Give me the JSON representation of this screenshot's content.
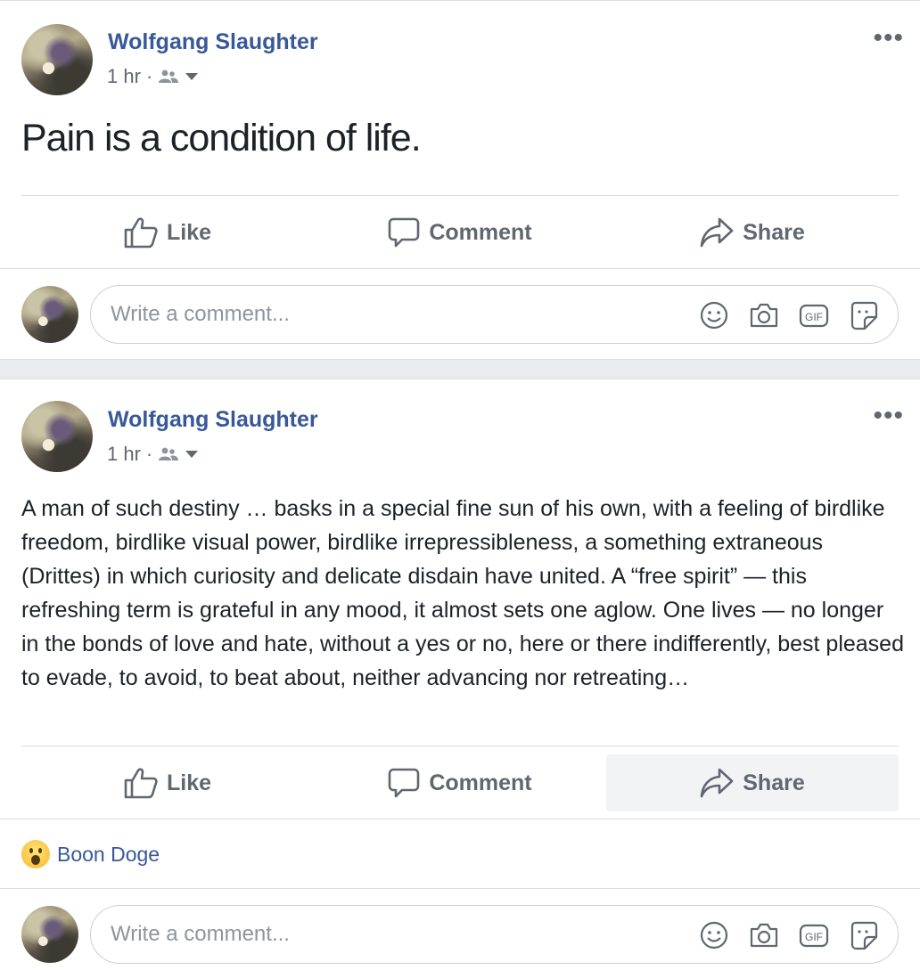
{
  "posts": [
    {
      "author": "Wolfgang Slaughter",
      "time": "1 hr",
      "separator": "·",
      "audience_icon": "friends-icon",
      "text": "Pain is a condition of life.",
      "actions": {
        "like": "Like",
        "comment": "Comment",
        "share": "Share"
      },
      "comment_placeholder": "Write a comment...",
      "comment_icons": [
        "emoji-icon",
        "camera-icon",
        "gif-icon",
        "sticker-icon"
      ]
    },
    {
      "author": "Wolfgang Slaughter",
      "time": "1 hr",
      "separator": "·",
      "audience_icon": "friends-icon",
      "text": "A man of such destiny … basks in a special fine sun of his own, with a feeling of birdlike freedom, birdlike visual power, birdlike irrepressibleness, a something extraneous (Drittes) in which curiosity and delicate disdain have united. A “free spirit” — this refreshing term is grateful in any mood, it almost sets one aglow. One lives — no longer in the bonds of love and hate, without a yes or no, here or there indifferently, best pleased to evade, to avoid, to beat about, neither advancing nor retreating…",
      "actions": {
        "like": "Like",
        "comment": "Comment",
        "share": "Share"
      },
      "reaction": {
        "type": "wow",
        "name": "Boon Doge"
      },
      "comment_placeholder": "Write a comment...",
      "comment_icons": [
        "emoji-icon",
        "camera-icon",
        "gif-icon",
        "sticker-icon"
      ]
    }
  ],
  "colors": {
    "link": "#385898",
    "text": "#1d2129",
    "muted": "#606770",
    "page_bg": "#e9ebee"
  }
}
